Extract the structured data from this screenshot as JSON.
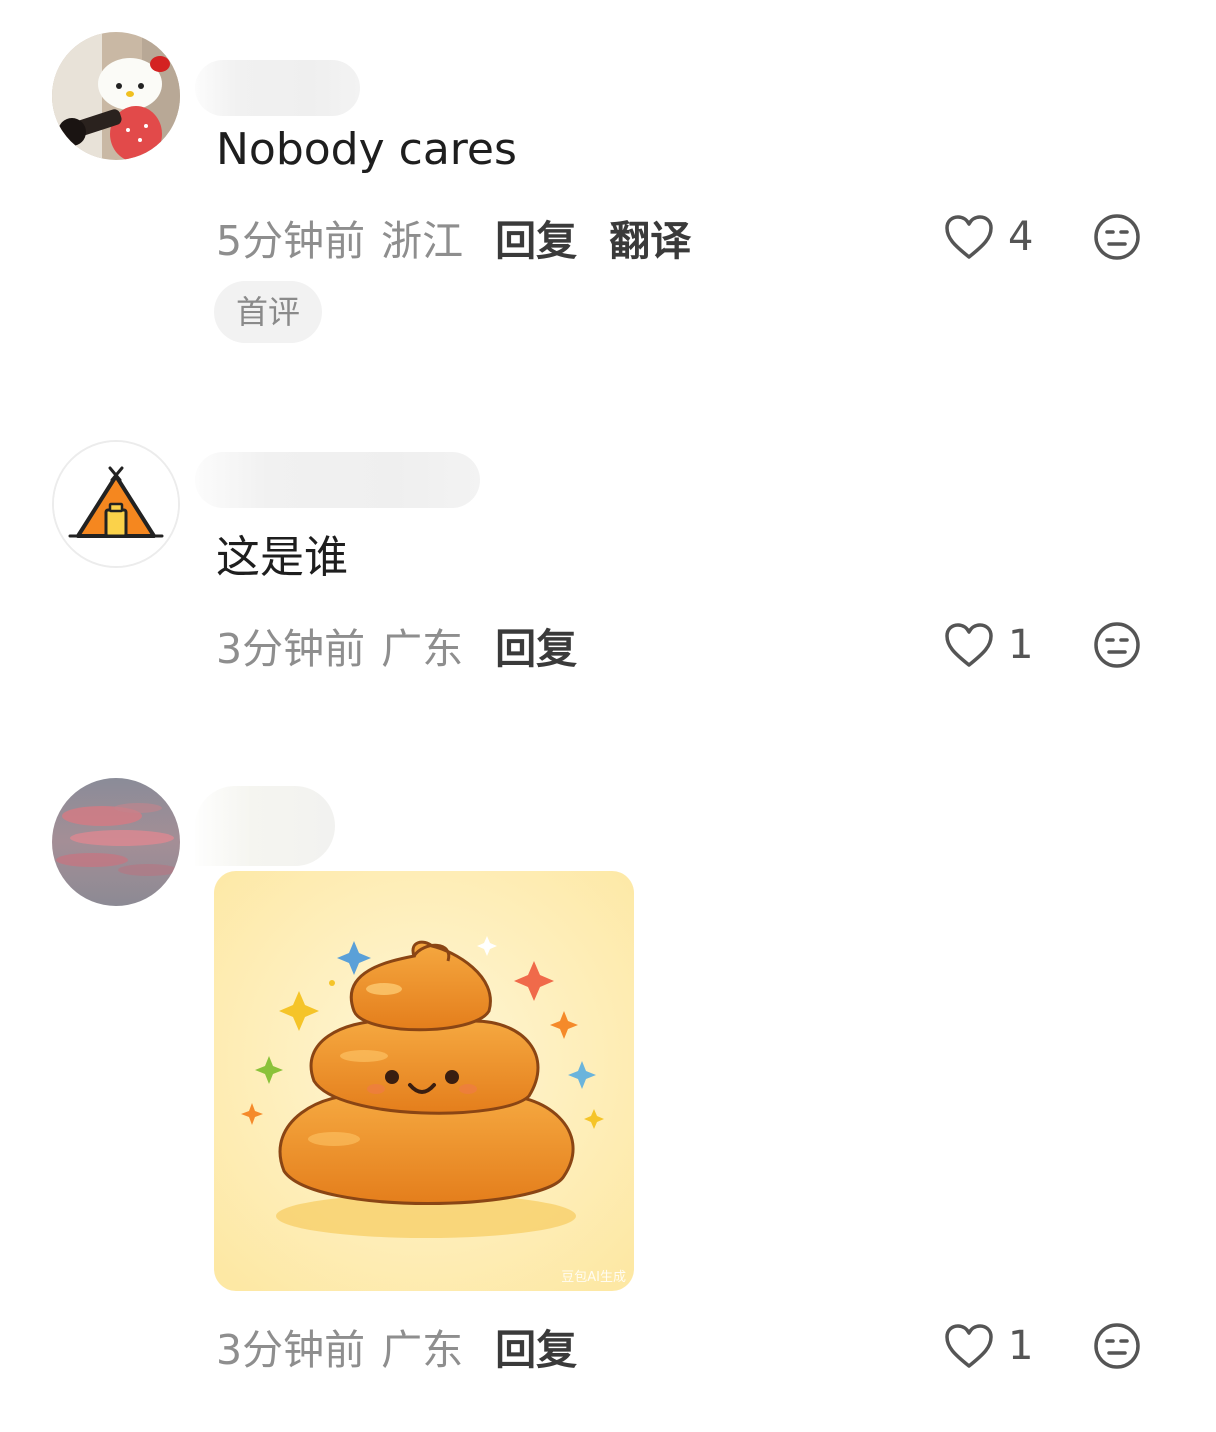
{
  "comments": [
    {
      "text": "Nobody cares",
      "time": "5分钟前",
      "region": "浙江",
      "reply_label": "回复",
      "translate_label": "翻译",
      "likes": "4",
      "badge": "首评",
      "avatar_icon": "hello-kitty-photo-avatar"
    },
    {
      "text": "这是谁",
      "time": "3分钟前",
      "region": "广东",
      "reply_label": "回复",
      "likes": "1",
      "avatar_icon": "tent-avatar"
    },
    {
      "image_desc": "cute-poop-sticker",
      "watermark": "豆包AI生成",
      "time": "3分钟前",
      "region": "广东",
      "reply_label": "回复",
      "likes": "1",
      "avatar_icon": "sunset-sky-avatar"
    }
  ],
  "colors": {
    "meta_gray": "#8e8e8e",
    "action_dark": "#3a3a3a",
    "badge_bg": "#f2f2f2",
    "tent_orange": "#f5871f",
    "poop_orange": "#e98a2a",
    "sticker_bg": "#fdecb0"
  }
}
